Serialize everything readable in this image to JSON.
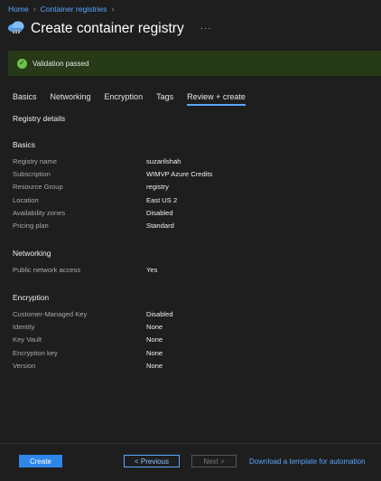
{
  "breadcrumb": {
    "items": [
      "Home",
      "Container registries"
    ]
  },
  "header": {
    "title": "Create container registry",
    "more_label": "···",
    "icon": "cloud-registry-icon"
  },
  "banner": {
    "message": "Validation passed",
    "status_color": "#6cc24a"
  },
  "tabs": [
    {
      "label": "Basics",
      "active": false
    },
    {
      "label": "Networking",
      "active": false
    },
    {
      "label": "Encryption",
      "active": false
    },
    {
      "label": "Tags",
      "active": false
    },
    {
      "label": "Review + create",
      "active": true
    }
  ],
  "registry_details_heading": "Registry details",
  "sections": {
    "basics": {
      "heading": "Basics",
      "rows": [
        {
          "label": "Registry name",
          "value": "suzarilshah"
        },
        {
          "label": "Subscription",
          "value": "WIMVP Azure Credits"
        },
        {
          "label": "Resource Group",
          "value": "registry"
        },
        {
          "label": "Location",
          "value": "East US 2"
        },
        {
          "label": "Availability zones",
          "value": "Disabled"
        },
        {
          "label": "Pricing plan",
          "value": "Standard"
        }
      ]
    },
    "networking": {
      "heading": "Networking",
      "rows": [
        {
          "label": "Public network access",
          "value": "Yes"
        }
      ]
    },
    "encryption": {
      "heading": "Encryption",
      "rows": [
        {
          "label": "Customer-Managed Key",
          "value": "Disabled"
        },
        {
          "label": "Identity",
          "value": "None"
        },
        {
          "label": "Key Vault",
          "value": "None"
        },
        {
          "label": "Encryption key",
          "value": "None"
        },
        {
          "label": "Version",
          "value": "None"
        }
      ]
    }
  },
  "footer": {
    "create_label": "Create",
    "previous_label": "< Previous",
    "next_label": "Next >",
    "template_link": "Download a template for automation"
  },
  "colors": {
    "accent": "#2f86ea",
    "link": "#5aa7ff",
    "banner_bg": "#263a17",
    "page_bg": "#1e1e1e"
  }
}
